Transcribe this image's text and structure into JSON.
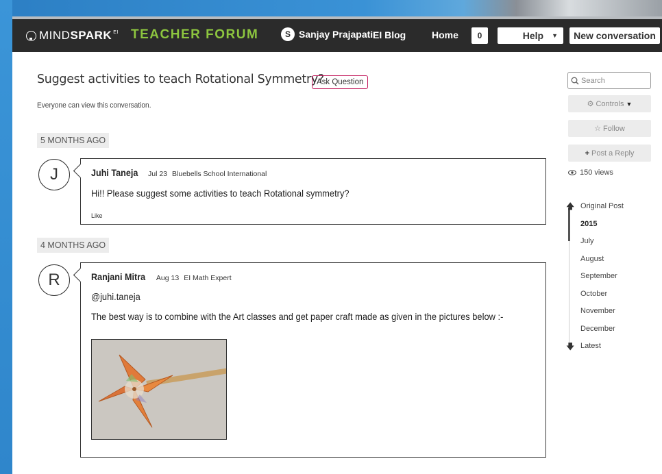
{
  "header": {
    "logo_light": "MIND",
    "logo_bold": "SPARK",
    "logo_sup": "EI",
    "forum_title": "TEACHER FORUM",
    "user_initial": "S",
    "user_name": "Sanjay Prajapati",
    "nav_blog": "EI Blog",
    "nav_home": "Home",
    "notification_count": "0",
    "help_label": "Help",
    "new_conversation_label": "New conversation"
  },
  "conversation": {
    "title": "Suggest activities to teach Rotational Symmetry?",
    "ask_question_label": "Ask Question",
    "visibility": "Everyone can view this conversation."
  },
  "separators": [
    "5 MONTHS AGO",
    "4 MONTHS AGO"
  ],
  "posts": [
    {
      "initial": "J",
      "author": "Juhi Taneja",
      "date": "Jul 23",
      "meta": "Bluebells School International",
      "body": "Hi!! Please suggest some activities to teach Rotational symmetry?",
      "like_label": "Like"
    },
    {
      "initial": "R",
      "author": "Ranjani Mitra",
      "date": "Aug 13",
      "meta": "EI Math Expert",
      "mention": "@juhi.taneja",
      "body": "The best way is to combine with the Art classes and get paper craft made as given in the pictures below :-"
    }
  ],
  "sidebar": {
    "search_placeholder": "Search",
    "controls_label": "Controls",
    "follow_label": "Follow",
    "post_reply_label": "Post a Reply",
    "views": "150 views",
    "timeline": {
      "original_post": "Original Post",
      "year": "2015",
      "months": [
        "July",
        "August",
        "September",
        "October",
        "November",
        "December"
      ],
      "latest": "Latest"
    }
  }
}
